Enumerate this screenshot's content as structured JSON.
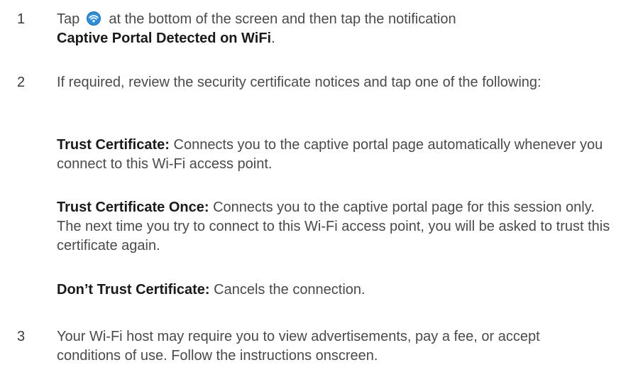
{
  "steps": [
    {
      "number": "1",
      "text_before_icon": "Tap",
      "icon": "wifi-icon",
      "text_after_icon": "at the bottom of the screen and then tap the notification",
      "bold_text": "Captive Portal Detected on WiFi",
      "trailing": "."
    },
    {
      "number": "2",
      "text": "If required, review the security certificate notices and tap one of the following:"
    },
    {
      "number": "3",
      "text": "Your Wi-Fi host may require you to view advertisements, pay a fee, or accept conditions of use. Follow the instructions onscreen."
    }
  ],
  "options": [
    {
      "label": "Trust Certificate:",
      "description": "Connects you to the captive portal page automatically whenever you connect to this Wi-Fi access point."
    },
    {
      "label": "Trust Certificate Once:",
      "description": "Connects you to the captive portal page for this session only. The next time you try to connect to this Wi-Fi access point, you will be asked to trust this certificate again."
    },
    {
      "label": "Don’t Trust Certificate:",
      "description": "Cancels the connection."
    }
  ],
  "colors": {
    "text": "#4a4a4a",
    "bold": "#1a1a1a",
    "icon": "#2f8fd6"
  }
}
